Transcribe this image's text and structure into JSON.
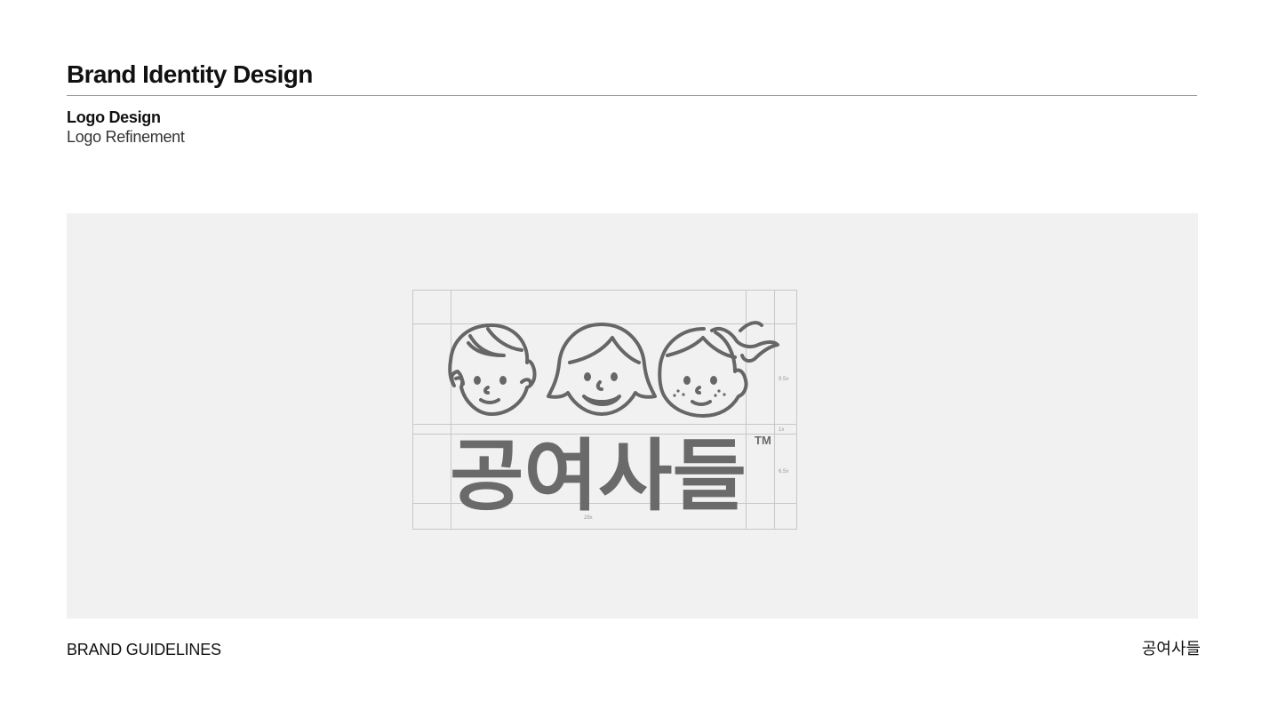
{
  "header": {
    "title": "Brand Identity Design"
  },
  "section": {
    "title": "Logo Design",
    "subtitle": "Logo Refinement"
  },
  "logo": {
    "wordmark": "공여사들",
    "trademark": "TM",
    "dimensions": {
      "face_height": "9.5x",
      "gap": "1x",
      "wordmark_height": "6.5x",
      "width": "28x"
    }
  },
  "footer": {
    "left": "BRAND GUIDELINES",
    "right": "공여사들"
  }
}
